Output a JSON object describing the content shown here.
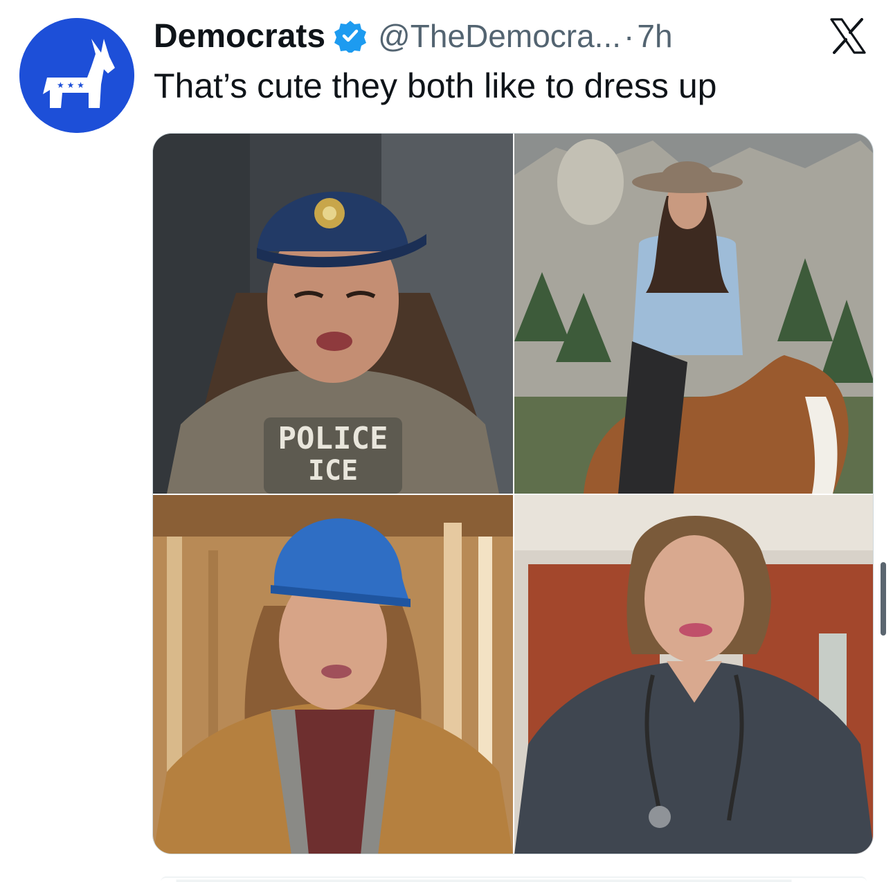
{
  "tweet": {
    "display_name": "Democrats",
    "verified_icon": "verified-badge-icon",
    "handle": "@TheDemocra...",
    "separator": "·",
    "time": "7h",
    "text": "That’s cute they both like to dress up",
    "avatar_icon": "democrat-donkey-logo",
    "close_icon": "x-logo-icon"
  },
  "media": {
    "images": [
      {
        "name": "police-ice-photo",
        "vest_line1": "POLICE",
        "vest_line2": "ICE"
      },
      {
        "name": "cowgirl-horse-photo"
      },
      {
        "name": "hard-hat-photo"
      },
      {
        "name": "nurse-scrubs-photo"
      }
    ]
  },
  "colors": {
    "brand_blue": "#1d4fd8",
    "verified_blue": "#1d9bf0",
    "secondary_text": "#536471"
  }
}
